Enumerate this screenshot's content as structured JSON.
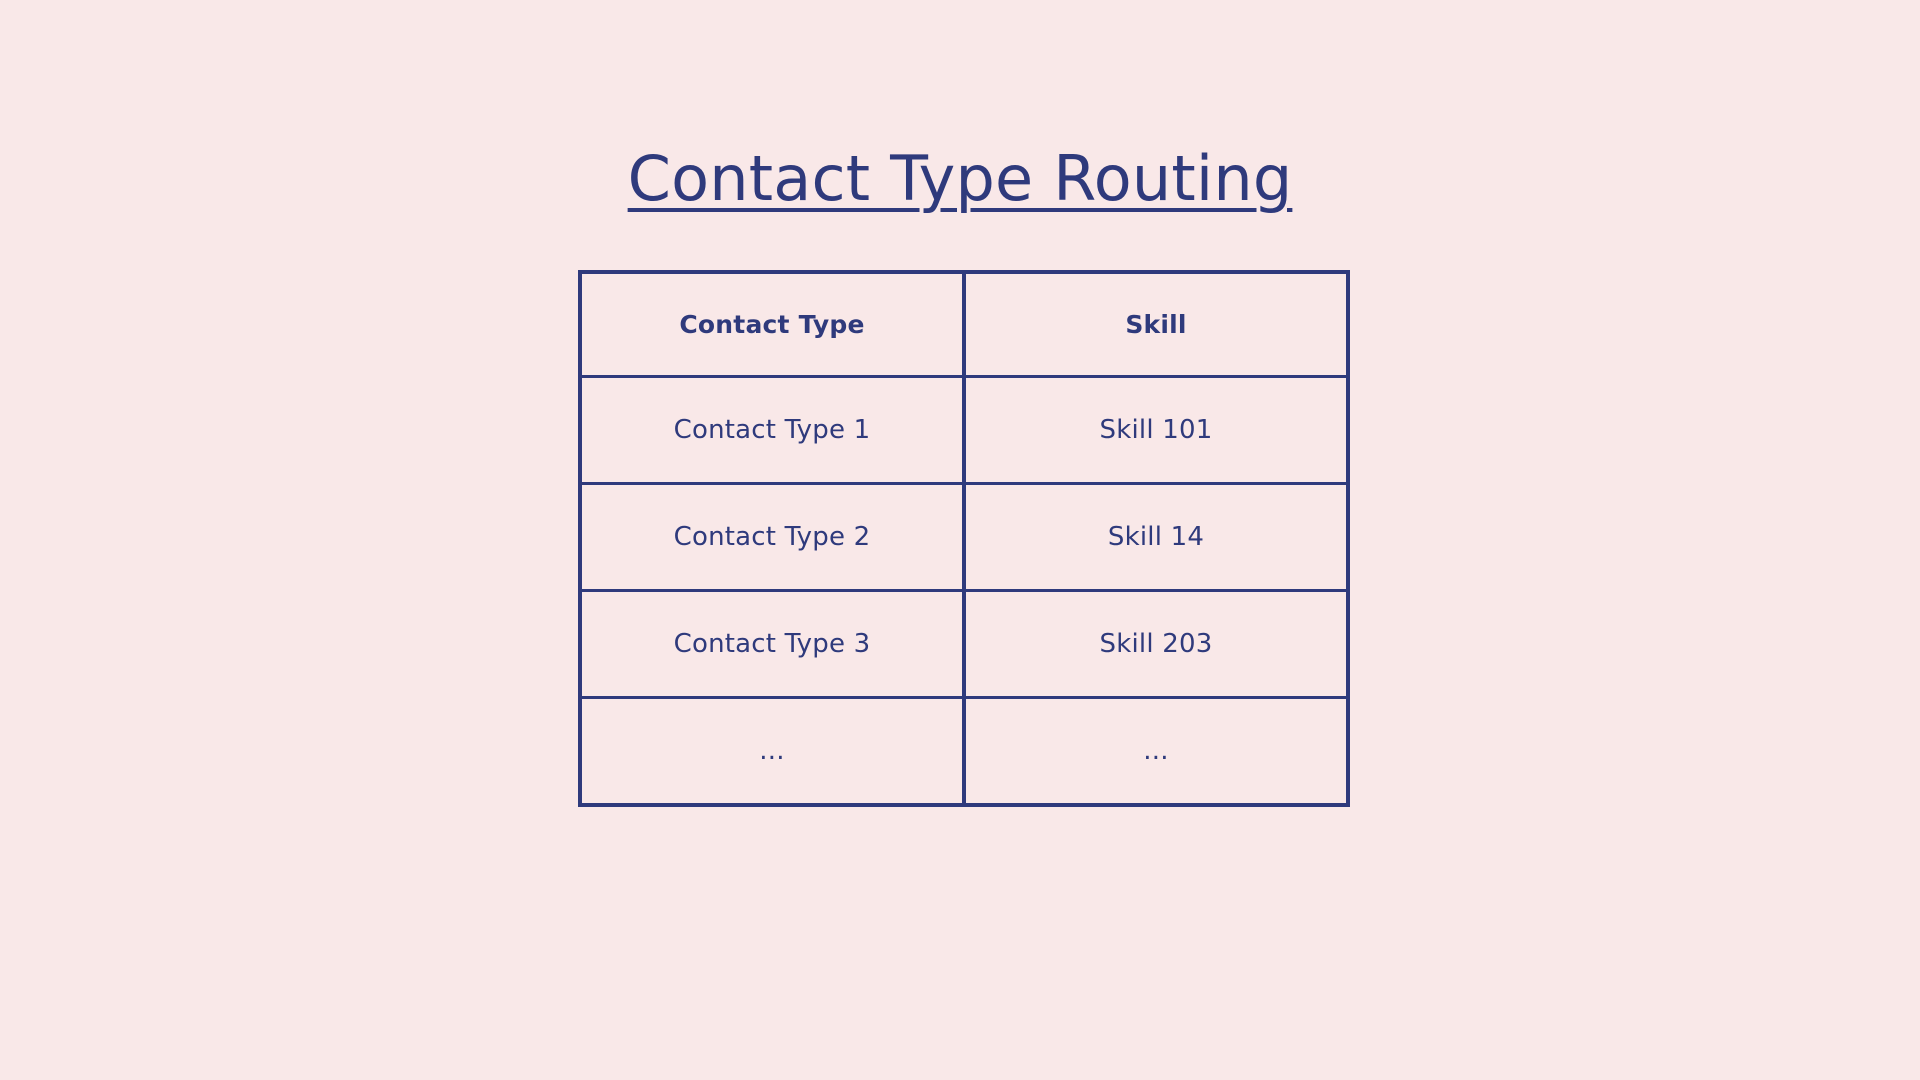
{
  "slide": {
    "background_color": "#f9e8e8",
    "accent_color": "#2f3a7c"
  },
  "title": {
    "text": "Contact Type Routing",
    "underlined": true,
    "color": "#2f3a7c"
  },
  "table": {
    "name": "contact-type-routing-table",
    "columns": [
      {
        "key": "contact_type",
        "header": "Contact Type"
      },
      {
        "key": "skill",
        "header": "Skill"
      }
    ],
    "rows": [
      {
        "contact_type": "Contact Type 1",
        "skill": "Skill 101"
      },
      {
        "contact_type": "Contact Type 2",
        "skill": "Skill 14"
      },
      {
        "contact_type": "Contact Type 3",
        "skill": "Skill 203"
      },
      {
        "contact_type": "...",
        "skill": "..."
      }
    ]
  }
}
